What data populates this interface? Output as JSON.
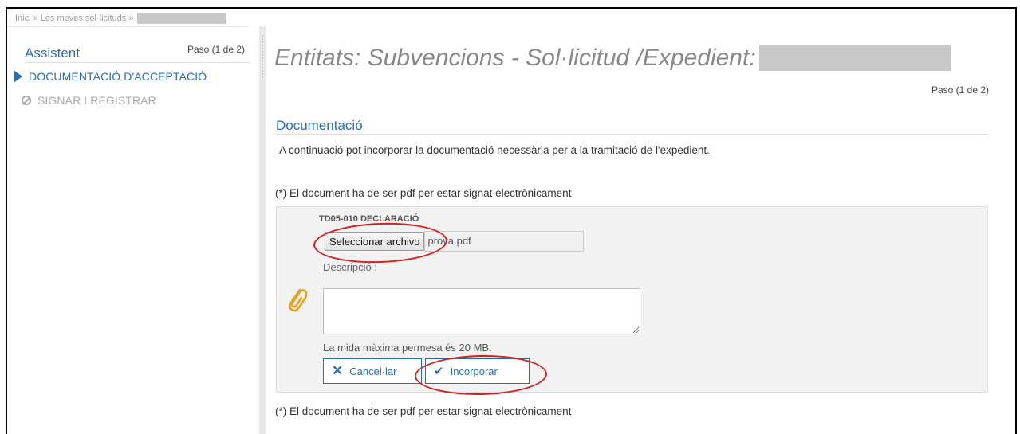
{
  "breadcrumb": {
    "items": [
      "Inici",
      "Les meves sol·licituds"
    ],
    "separator": "»"
  },
  "sidebar": {
    "title": "Assistent",
    "step_indicator": "Paso (1 de 2)",
    "steps": [
      {
        "label": "DOCUMENTACIÓ D'ACCEPTACIÓ",
        "state": "active",
        "icon": "triangle-right-icon"
      },
      {
        "label": "SIGNAR I REGISTRAR",
        "state": "disabled",
        "icon": "ban-icon"
      }
    ]
  },
  "main": {
    "page_title": "Entitats: Subvencions - Sol·licitud /Expedient:",
    "step_indicator": "Paso (1 de 2)",
    "section_title": "Documentació",
    "intro": "A continuació pot incorporar la documentació necessària per a la tramitació de l'expedient.",
    "note": "(*) El document ha de ser pdf per estar signat electrònicament",
    "upload": {
      "document_name": "TD05-010 DECLARACIÓ",
      "file_button_label": "Seleccionar archivo",
      "file_name": "prova.pdf",
      "description_label": "Descripció :",
      "description_value": "",
      "max_size": "La mida màxima permesa és 20 MB.",
      "cancel_label": "Cancel·lar",
      "submit_label": "Incorporar",
      "icons": {
        "attach": "paperclip-icon",
        "cancel": "x-icon",
        "submit": "check-icon"
      }
    }
  },
  "colors": {
    "accent": "#2a6db0",
    "annotation": "#d61f1f",
    "attach_icon": "#e8a020",
    "redacted": "#c8c8c8"
  }
}
